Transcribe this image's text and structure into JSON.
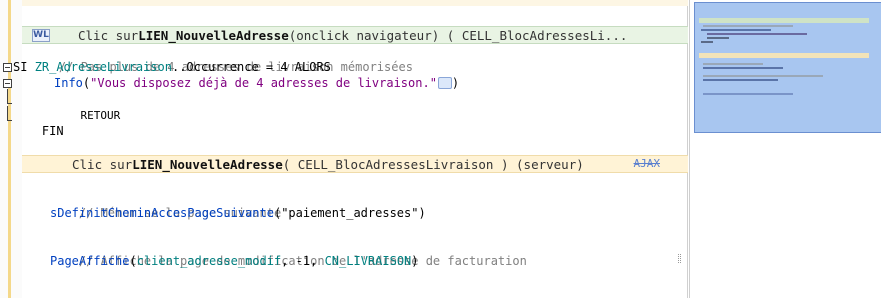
{
  "header1": {
    "badge": "WL",
    "prefix": "Clic sur ",
    "control": "LIEN_NouvelleAdresse",
    "suffix": "  (onclick navigateur)  ( CELL_BlocAdressesLi..."
  },
  "code1": {
    "comment": "// Pas plus de 4 adresses de livraison mémorisées",
    "si_kw": "SI ",
    "si_var": "ZR_AdresseLivraison",
    "si_rest": "..Occurrence = 4 ALORS",
    "info_func": "Info",
    "info_open": "(",
    "info_str": "\"Vous disposez déjà de 4 adresses de livraison.\"",
    "info_close": ")",
    "retour": "RETOUR",
    "fin": "FIN"
  },
  "header2": {
    "prefix": "Clic sur ",
    "control": "LIEN_NouvelleAdresse",
    "suffix": "  ( CELL_BlocAdressesLivraison ) (serveur)",
    "ajax": "AJAX"
  },
  "code2": {
    "comment1": "// Mémorise la page suivante",
    "call1_func": "sDefinitCheminAccesPageSuivante",
    "call1_arg": "(\"paiement_adresses\")",
    "comment2": "// Affiche la page de modification de l'adresse de facturation",
    "call2_func": "PageAffiche",
    "call2_open": "(",
    "call2_var": "client_adresse_modif",
    "call2_mid": ", -1, ",
    "call2_const": "CN_LIVRAISON",
    "call2_close": ")"
  },
  "colors": {
    "header1_bg": "#e9f4e4",
    "header2_bg": "#fff3d6",
    "comment": "#808080",
    "function": "#0040c0",
    "variable": "#008080",
    "string": "#800080",
    "minimap_view": "#a8c6f0"
  }
}
